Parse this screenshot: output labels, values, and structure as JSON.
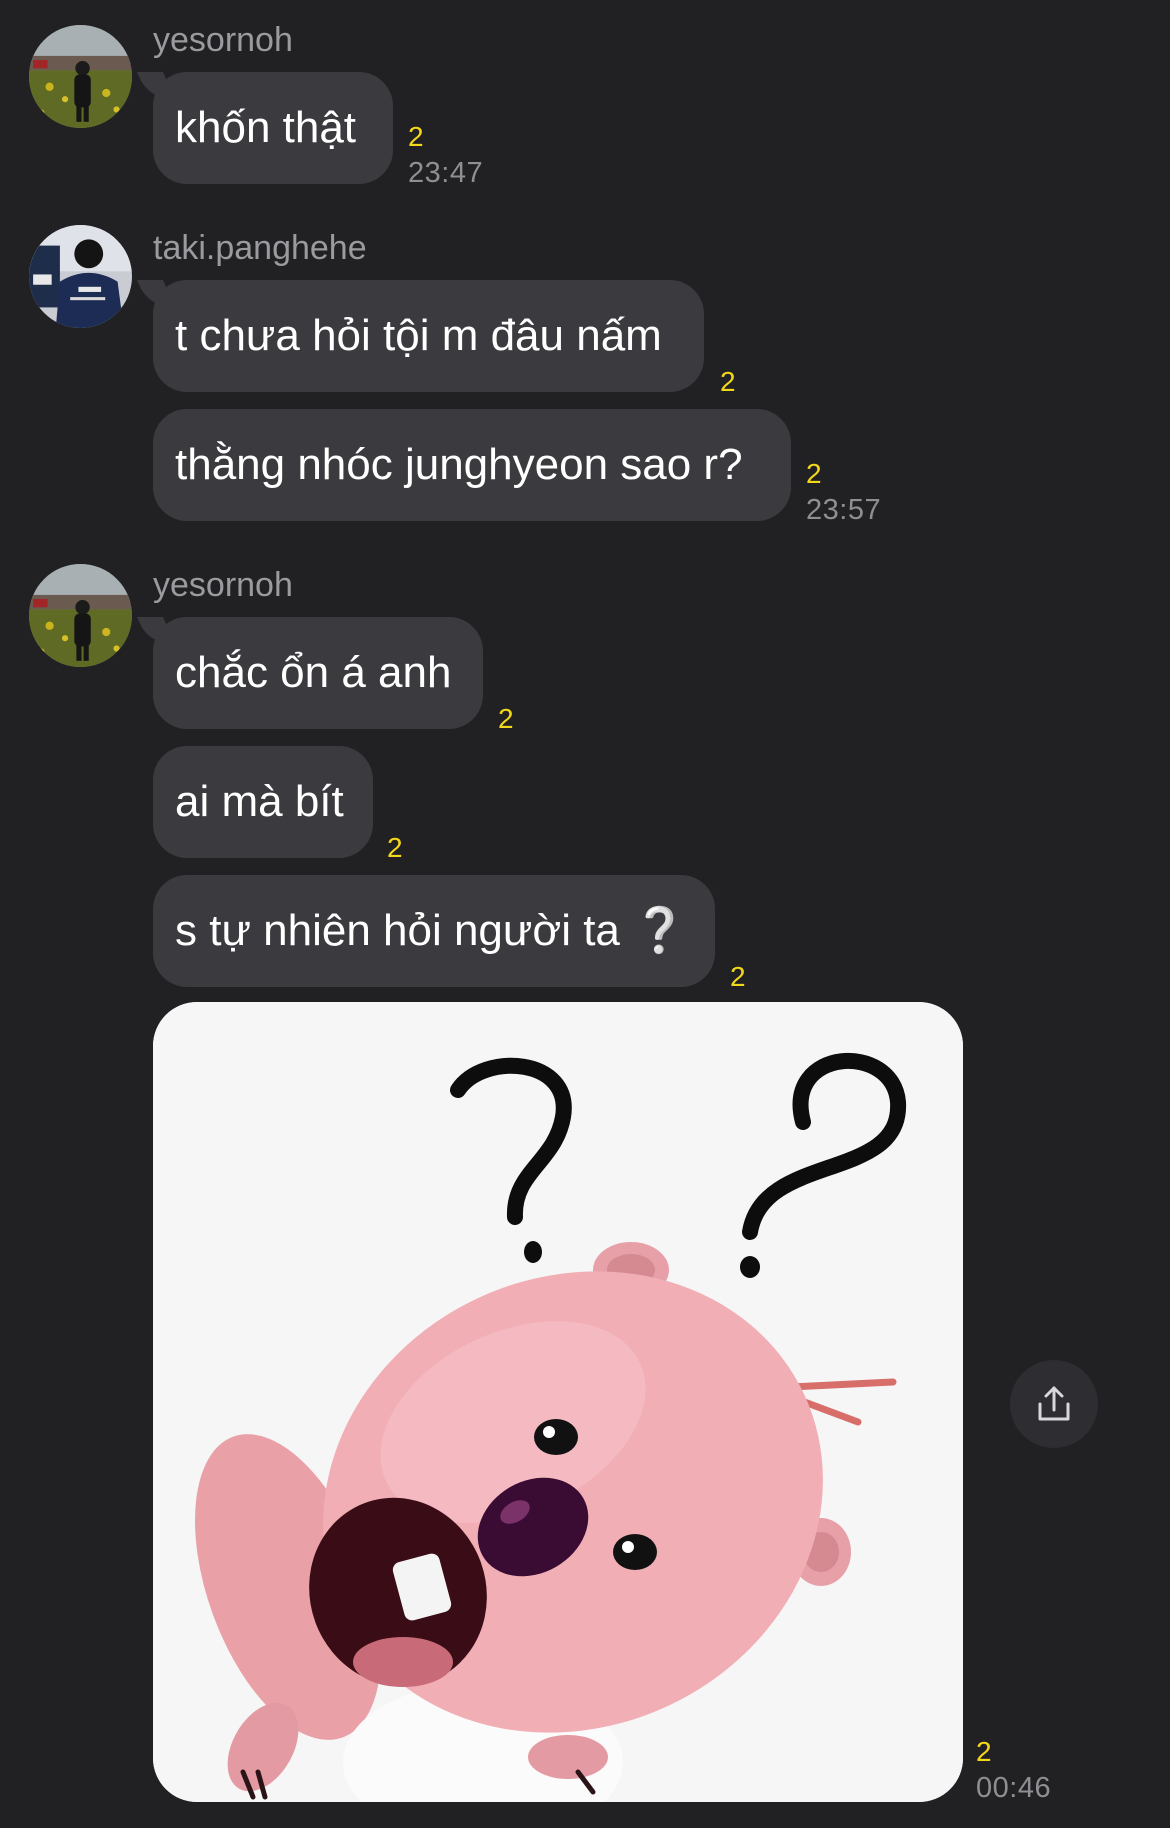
{
  "messages": {
    "group1": {
      "sender": "yesornoh",
      "avatar_icon": "user-avatar-field-icon",
      "bubbles": [
        {
          "text": "khốn thật",
          "unread": "2",
          "time": "23:47"
        }
      ]
    },
    "group2": {
      "sender": "taki.panghehe",
      "avatar_icon": "user-avatar-jacket-icon",
      "bubbles": [
        {
          "text": "t chưa hỏi tội m đâu nấm",
          "unread": "2"
        },
        {
          "text": "thằng nhóc junghyeon sao r?",
          "unread": "2",
          "time": "23:57"
        }
      ]
    },
    "group3": {
      "sender": "yesornoh",
      "avatar_icon": "user-avatar-field-icon",
      "bubbles": [
        {
          "text": "chắc ổn á anh",
          "unread": "2"
        },
        {
          "text": "ai mà bít",
          "unread": "2"
        },
        {
          "text": "s tự nhiên hỏi người ta ❔",
          "unread": "2"
        }
      ],
      "sticker": {
        "icon": "confused-pink-beaver-sticker",
        "unread": "2",
        "time": "00:46"
      }
    }
  },
  "actions": {
    "share_icon": "share-icon"
  },
  "colors": {
    "background": "#212124",
    "bubble": "#3b3b3f",
    "unread_count": "#f2d71b",
    "meta_text": "#8e8e93"
  }
}
